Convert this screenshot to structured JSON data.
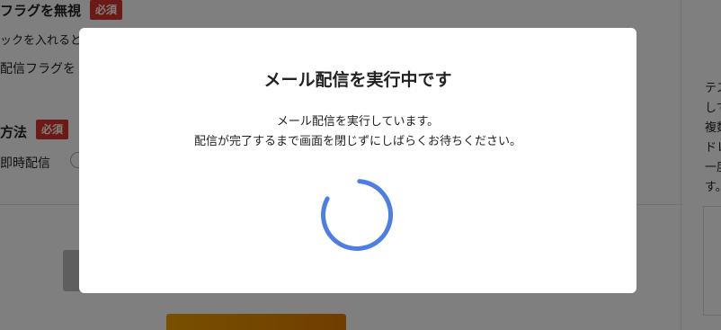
{
  "background": {
    "ignore_flag_label": "フラグを無視",
    "required_badge": "必須",
    "check_note": "ックを入れると配",
    "delivery_flag_label": "配信フラグを",
    "method_label": "方法",
    "method_required_badge": "必須",
    "immediate_delivery_label": "即時配信",
    "submit_label": "",
    "side_text_lines": [
      "テス",
      "して",
      "複数",
      "ドレ",
      "一度",
      "す。"
    ],
    "side_card_lines": [
      "I",
      "I"
    ]
  },
  "modal": {
    "title": "メール配信を実行中です",
    "message_line1": "メール配信を実行しています。",
    "message_line2": "配信が完了するまで画面を閉じずにしばらくお待ちください。"
  },
  "colors": {
    "spinner": "#4c7ee6",
    "badge": "#d9342b",
    "accent": "#f0a000"
  },
  "icons": {
    "spinner": "loading-spinner-icon"
  }
}
